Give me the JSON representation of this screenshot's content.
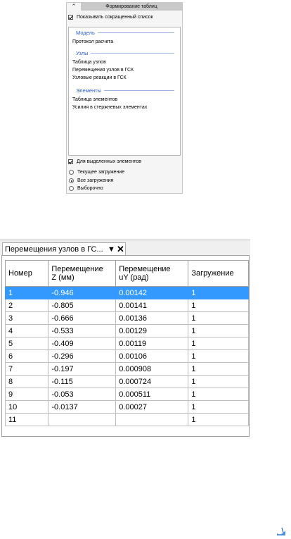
{
  "panel": {
    "title": "Формирование таблиц",
    "show_short_list": "Показывать сокращенный список",
    "groups": {
      "model": {
        "header": "Модель",
        "items": [
          "Протокол расчета"
        ]
      },
      "nodes": {
        "header": "Узлы",
        "items": [
          "Таблица узлов",
          "Перемещения узлов в ГСК",
          "Узловые реакции в ГСК"
        ]
      },
      "elements": {
        "header": "Элементы",
        "items": [
          "Таблица элементов",
          "Усилия в стержневых элементах"
        ]
      }
    },
    "for_selected": "Для выделенных элементов",
    "load_options": [
      {
        "label": "Текущее загружение",
        "selected": false
      },
      {
        "label": "Все загружения",
        "selected": true
      },
      {
        "label": "Выборочно",
        "selected": false
      }
    ]
  },
  "table_window": {
    "tab_label": "Перемещения узлов в ГС...",
    "columns": [
      "Номер",
      "Перемещение Z (мм)",
      "Перемещение uY (рад)",
      "Загружение"
    ],
    "column_lines": [
      [
        "Номер",
        ""
      ],
      [
        "Перемещение",
        "Z (мм)"
      ],
      [
        "Перемещение",
        "uY (рад)"
      ],
      [
        "Загружение",
        ""
      ]
    ],
    "selected_row": 0,
    "rows": [
      [
        "1",
        "-0.946",
        "0.00142",
        "1"
      ],
      [
        "2",
        "-0.805",
        "0.00141",
        "1"
      ],
      [
        "3",
        "-0.666",
        "0.00136",
        "1"
      ],
      [
        "4",
        "-0.533",
        "0.00129",
        "1"
      ],
      [
        "5",
        "-0.409",
        "0.00119",
        "1"
      ],
      [
        "6",
        "-0.296",
        "0.00106",
        "1"
      ],
      [
        "7",
        "-0.197",
        "0.000908",
        "1"
      ],
      [
        "8",
        "-0.115",
        "0.000724",
        "1"
      ],
      [
        "9",
        "-0.053",
        "0.000511",
        "1"
      ],
      [
        "10",
        "-0.0137",
        "0.00027",
        "1"
      ],
      [
        "11",
        "",
        "",
        "1"
      ]
    ]
  },
  "colors": {
    "selection": "#3399ff",
    "group_header": "#2b57c9"
  },
  "icons": {
    "collapse": "double-chevron-up-icon",
    "tab_menu": "dropdown-arrow-icon",
    "tab_close": "close-icon",
    "logo": "app-logo-icon"
  }
}
